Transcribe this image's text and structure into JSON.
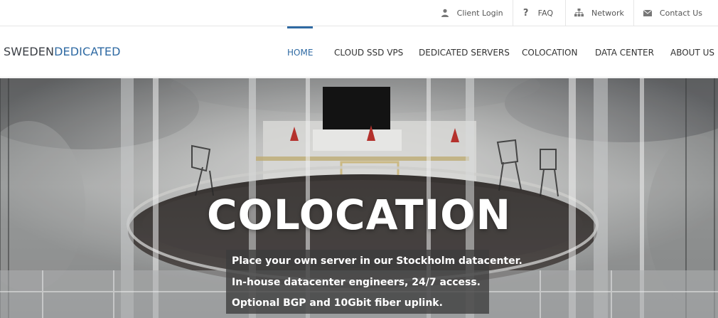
{
  "topbar": {
    "links": [
      {
        "label": "Client Login",
        "icon": "user-icon"
      },
      {
        "label": "FAQ",
        "icon": "question-icon"
      },
      {
        "label": "Network",
        "icon": "sitemap-icon"
      },
      {
        "label": "Contact Us",
        "icon": "envelope-icon"
      }
    ]
  },
  "logo": {
    "part1": "SWEDEN",
    "part2": "DEDICATED"
  },
  "nav": {
    "items": [
      {
        "label": "HOME",
        "active": true
      },
      {
        "label": "CLOUD SSD VPS"
      },
      {
        "label": "DEDICATED SERVERS"
      },
      {
        "label": "COLOCATION"
      },
      {
        "label": "DATA CENTER"
      },
      {
        "label": "ABOUT US"
      }
    ]
  },
  "hero": {
    "title": "COLOCATION",
    "lines": [
      "Place your own server in our Stockholm datacenter.",
      "In-house datacenter engineers, 24/7 access.",
      "Optional BGP and 10Gbit fiber uplink."
    ]
  },
  "colors": {
    "accent": "#2f6aa3",
    "text": "#333333",
    "overlay": "rgba(60,60,60,0.78)"
  }
}
